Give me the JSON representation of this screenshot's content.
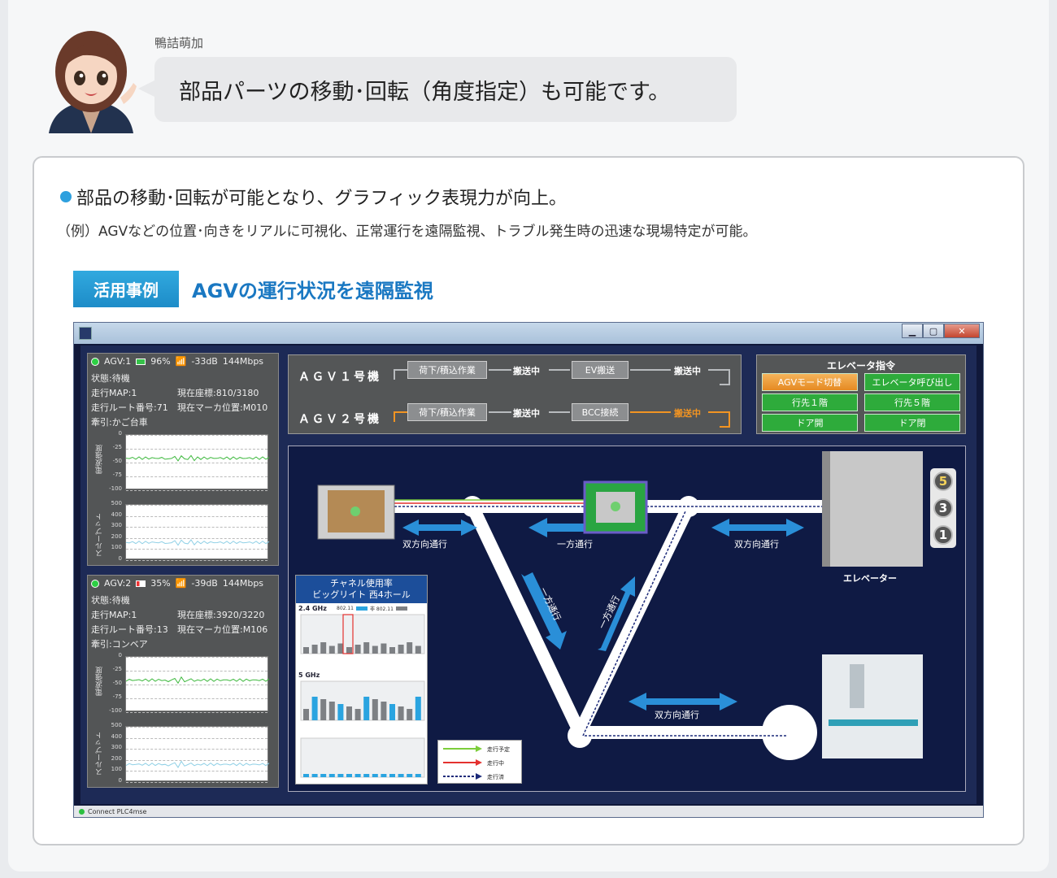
{
  "speaker": {
    "name": "鴨詰萌加",
    "message": "部品パーツの移動･回転（角度指定）も可能です。"
  },
  "feature": {
    "bullet": "部品の移動･回転が可能となり、グラフィック表現力が向上。",
    "example": "（例）AGVなどの位置･向きをリアルに可視化、正常運行を遠隔監視、トラブル発生時の迅速な現場特定が可能。"
  },
  "case": {
    "tag": "活用事例",
    "title": "AGVの運行状況を遠隔監視"
  },
  "window": {
    "status_text": "Connect PLC4mse"
  },
  "agv_panels": [
    {
      "header": "AGV:1",
      "battery": "96%",
      "signal": "-33dB",
      "speed": "144Mbps",
      "status": "状態:待機",
      "map": "走行MAP:1",
      "coord": "現在座標:810/3180",
      "route": "走行ルート番号:71",
      "marker": "現在マーカ位置:M010",
      "tow": "牽引:かご台車",
      "signal_label": "電波強度",
      "signal_ticks": [
        "0",
        "-25",
        "-50",
        "-75",
        "-100"
      ],
      "thru_label": "スループット",
      "thru_ticks": [
        "500",
        "400",
        "300",
        "200",
        "100",
        "0"
      ]
    },
    {
      "header": "AGV:2",
      "battery": "35%",
      "signal": "-39dB",
      "speed": "144Mbps",
      "status": "状態:待機",
      "map": "走行MAP:1",
      "coord": "現在座標:3920/3220",
      "route": "走行ルート番号:13",
      "marker": "現在マーカ位置:M106",
      "tow": "牽引:コンベア",
      "signal_label": "電波強度",
      "signal_ticks": [
        "0",
        "-25",
        "-50",
        "-75",
        "-100"
      ],
      "thru_label": "スループット",
      "thru_ticks": [
        "500",
        "400",
        "300",
        "200",
        "100",
        "0"
      ]
    }
  ],
  "flow": {
    "agv1": {
      "label": "ＡＧＶ１号機",
      "step1": "荷下/積込作業",
      "t1": "搬送中",
      "step2": "EV搬送",
      "t2": "搬送中"
    },
    "agv2": {
      "label": "ＡＧＶ２号機",
      "step1": "荷下/積込作業",
      "t1": "搬送中",
      "step2": "BCC接続",
      "t2": "搬送中"
    },
    "colors": {
      "normal": "#b8bbbe",
      "active": "#f29422"
    }
  },
  "elevator_cmd": {
    "title": "エレベータ指令",
    "buttons": [
      "AGVモード切替",
      "エレベータ呼び出し",
      "行先１階",
      "行先５階",
      "ドア開",
      "ドア閉"
    ]
  },
  "channel": {
    "title1": "チャネル使用率",
    "title2": "ビッグリイト 西4ホール",
    "band1": "2.4 GHz",
    "band2": "5 GHz",
    "legend_a": "802.11",
    "legend_b": "非 802.11"
  },
  "map_labels": {
    "two_way_1": "双方向通行",
    "one_way_top": "一方通行",
    "two_way_2": "双方向通行",
    "one_way_left": "一方通行",
    "one_way_right": "一方通行",
    "two_way_bottom": "双方向通行",
    "elevator": "エレベーター"
  },
  "legend": {
    "planned": "走行予定",
    "running": "走行中",
    "done": "走行済"
  },
  "floors": [
    "5",
    "3",
    "1"
  ]
}
